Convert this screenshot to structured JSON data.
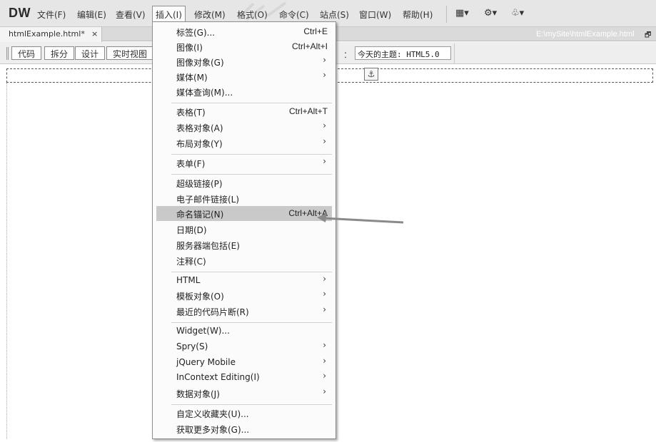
{
  "app": {
    "logo": "DW",
    "menus": [
      "文件(F)",
      "编辑(E)",
      "查看(V)",
      "插入(I)",
      "修改(M)",
      "格式(O)",
      "命令(C)",
      "站点(S)",
      "窗口(W)",
      "帮助(H)"
    ],
    "toolbar_icons": [
      "layout-icon",
      "gear-icon",
      "site-icon"
    ]
  },
  "tab": {
    "name": "htmlExample.html*",
    "close": "×",
    "path": "E:\\mySite\\htmlExample.html"
  },
  "doc_toolbar": {
    "views": [
      "代码",
      "拆分",
      "设计",
      "实时视图"
    ],
    "active_view": "设计",
    "title_label": "：",
    "title_value": "今天的主题: HTML5.0"
  },
  "insert_menu": {
    "groups": [
      [
        {
          "label": "标签(G)...",
          "shortcut": "Ctrl+E"
        },
        {
          "label": "图像(I)",
          "shortcut": "Ctrl+Alt+I"
        },
        {
          "label": "图像对象(G)",
          "submenu": true
        },
        {
          "label": "媒体(M)",
          "submenu": true
        },
        {
          "label": "媒体查询(M)..."
        }
      ],
      [
        {
          "label": "表格(T)",
          "shortcut": "Ctrl+Alt+T"
        },
        {
          "label": "表格对象(A)",
          "submenu": true
        },
        {
          "label": "布局对象(Y)",
          "submenu": true
        }
      ],
      [
        {
          "label": "表单(F)",
          "submenu": true
        }
      ],
      [
        {
          "label": "超级链接(P)"
        },
        {
          "label": "电子邮件链接(L)"
        },
        {
          "label": "命名锚记(N)",
          "shortcut": "Ctrl+Alt+A",
          "highlighted": true
        },
        {
          "label": "日期(D)"
        },
        {
          "label": "服务器端包括(E)"
        },
        {
          "label": "注释(C)"
        }
      ],
      [
        {
          "label": "HTML",
          "submenu": true
        },
        {
          "label": "模板对象(O)",
          "submenu": true
        },
        {
          "label": "最近的代码片断(R)",
          "submenu": true
        }
      ],
      [
        {
          "label": "Widget(W)..."
        },
        {
          "label": "Spry(S)",
          "submenu": true
        },
        {
          "label": "jQuery Mobile",
          "submenu": true
        },
        {
          "label": "InContext Editing(I)",
          "submenu": true
        },
        {
          "label": "数据对象(J)",
          "submenu": true
        }
      ],
      [
        {
          "label": "自定义收藏夹(U)..."
        },
        {
          "label": "获取更多对象(G)..."
        }
      ]
    ],
    "arrow_glyph": "›"
  },
  "colors": {
    "menubar_bg": "#e6e6e6",
    "menu_highlight": "#c9c9c9",
    "pointer": "#8a8a8a"
  }
}
